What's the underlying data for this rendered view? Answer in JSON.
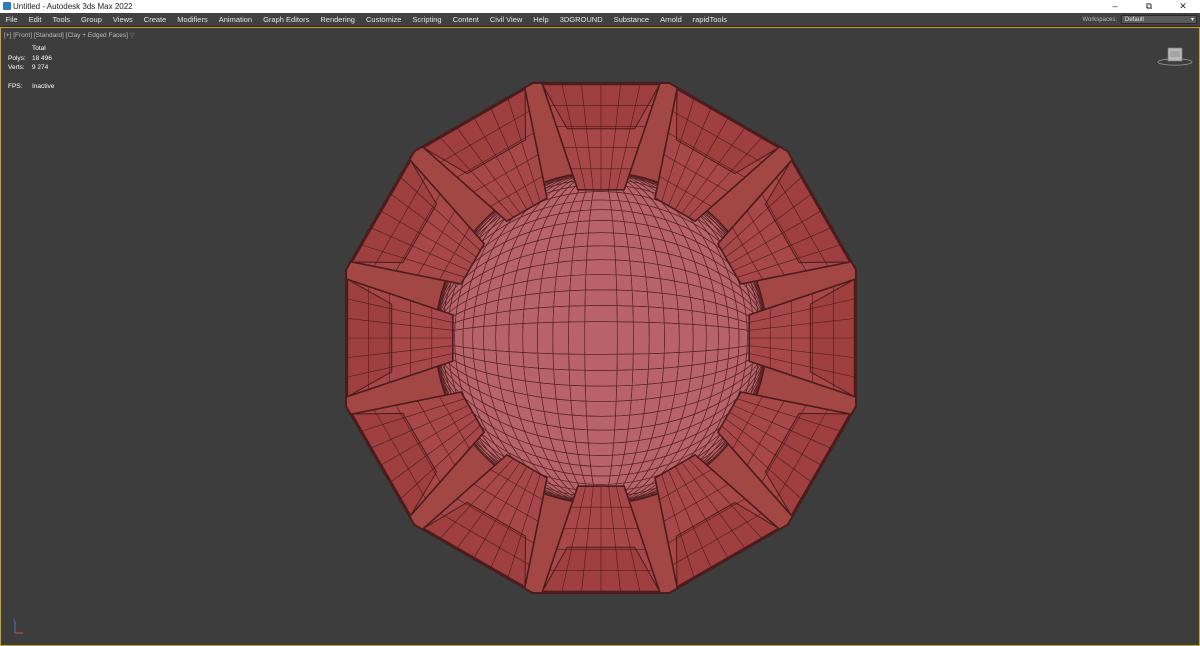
{
  "window": {
    "title": "Untitled - Autodesk 3ds Max 2022",
    "controls": {
      "minimize": "–",
      "restore": "⧉",
      "close": "✕"
    }
  },
  "menubar": {
    "items": [
      "File",
      "Edit",
      "Tools",
      "Group",
      "Views",
      "Create",
      "Modifiers",
      "Animation",
      "Graph Editors",
      "Rendering",
      "Customize",
      "Scripting",
      "Content",
      "Civil View",
      "Help",
      "3DGROUND",
      "Substance",
      "Arnold",
      "rapidTools"
    ],
    "workspaces_label": "Workspaces:",
    "workspace_value": "Default"
  },
  "viewport": {
    "label_prefix": "[+]",
    "view": "[Front]",
    "shading_mode": "[Standard]",
    "display": "[Clay + Edged Faces]",
    "stats": {
      "header": "Total",
      "polys_label": "Polys:",
      "polys_value": "18 496",
      "verts_label": "Verts:",
      "verts_value": "9 274",
      "fps_label": "FPS:",
      "fps_value": "Inactive"
    }
  },
  "colors": {
    "viewport_bg": "#3d3d3d",
    "active_border": "#c8a330",
    "panel_fill": "#a34744",
    "inner_fill": "#b8636a",
    "wire": "#4a1c1c"
  },
  "icons": {
    "viewcube": "viewcube-icon",
    "axis_tripod": "axis-tripod-icon",
    "app": "autodesk-3dsmax-icon",
    "filter": "filter-icon"
  }
}
